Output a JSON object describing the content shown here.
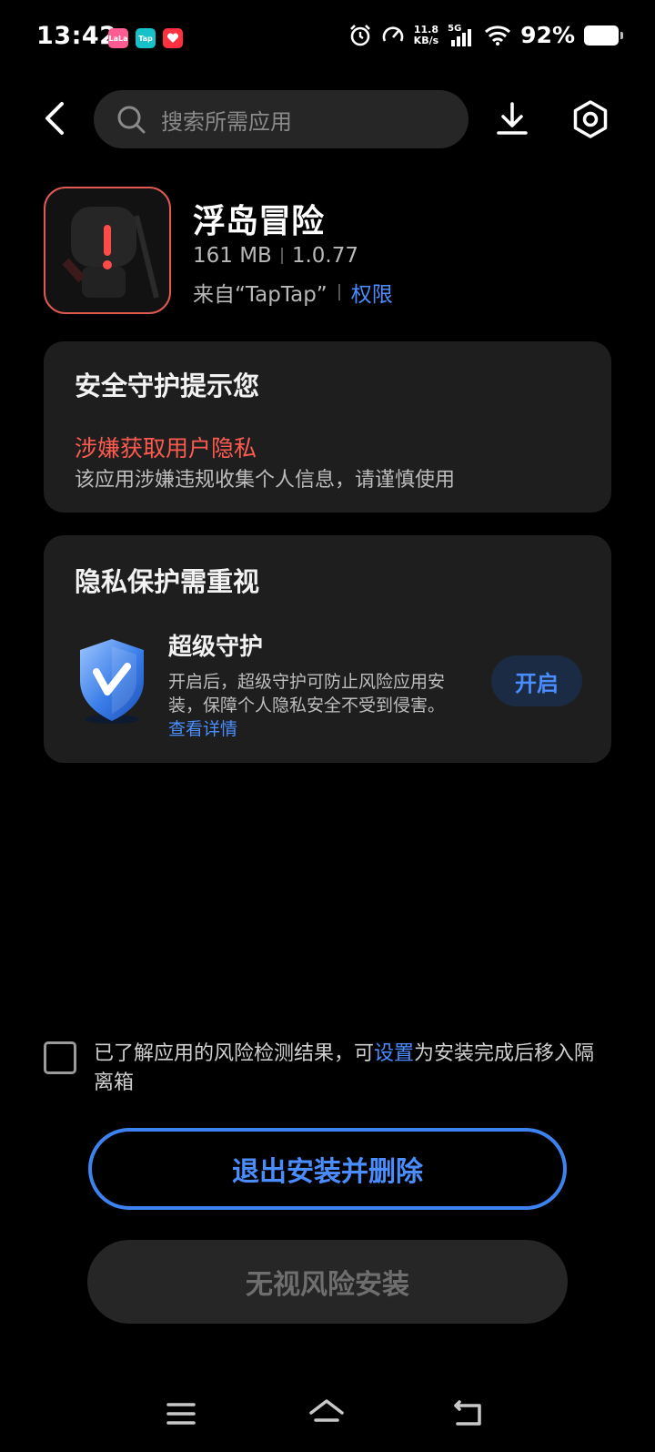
{
  "status_bar": {
    "time": "13:42",
    "net_speed_value": "11.8",
    "net_speed_unit": "KB/s",
    "network": "5G",
    "battery": "92%",
    "notifications": [
      {
        "text": "LaLa",
        "color": "#ff5c93"
      },
      {
        "text": "Tap",
        "color": "#16c1c9"
      },
      {
        "text": "",
        "color": "#ff3040"
      }
    ]
  },
  "search": {
    "placeholder": "搜索所需应用"
  },
  "app": {
    "name": "浮岛冒险",
    "size": "161 MB",
    "version": "1.0.77",
    "source": "来自“TapTap”",
    "permissions_link": "权限"
  },
  "security_card": {
    "title": "安全守护提示您",
    "warning_title": "涉嫌获取用户隐私",
    "warning_desc": "该应用涉嫌违规收集个人信息，请谨慎使用"
  },
  "privacy_card": {
    "title": "隐私保护需重视",
    "feature_title": "超级守护",
    "feature_desc": "开启后，超级守护可防止风险应用安装，保障个人隐私安全不受到侵害。",
    "details_link": "查看详情",
    "enable_button": "开启"
  },
  "agreement": {
    "text_before": "已了解应用的风险检测结果，可",
    "settings_link": "设置",
    "text_after": "为安装完成后移入隔离箱"
  },
  "buttons": {
    "exit_and_delete": "退出安装并删除",
    "ignore_risk_install": "无视风险安装"
  },
  "colors": {
    "accent": "#4a8dff",
    "warning": "#ff5a50",
    "card_bg": "#1e1e1e",
    "background": "#000000"
  }
}
